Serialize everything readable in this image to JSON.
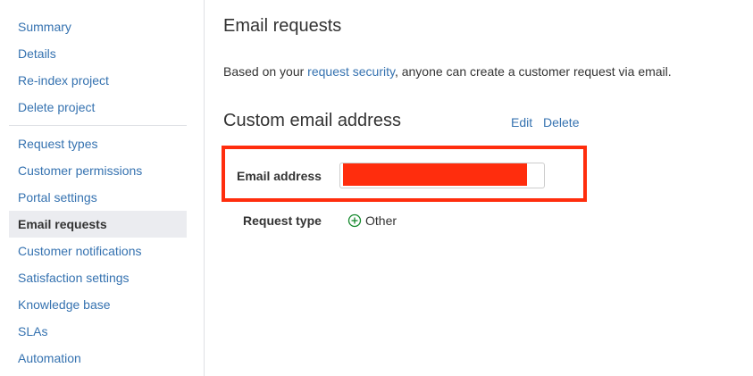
{
  "sidebar": {
    "group1": [
      {
        "label": "Summary"
      },
      {
        "label": "Details"
      },
      {
        "label": "Re-index project"
      },
      {
        "label": "Delete project"
      }
    ],
    "group2": [
      {
        "label": "Request types"
      },
      {
        "label": "Customer permissions"
      },
      {
        "label": "Portal settings"
      },
      {
        "label": "Email requests",
        "active": true
      },
      {
        "label": "Customer notifications"
      },
      {
        "label": "Satisfaction settings"
      },
      {
        "label": "Knowledge base"
      },
      {
        "label": "SLAs"
      },
      {
        "label": "Automation"
      }
    ]
  },
  "main": {
    "title": "Email requests",
    "intro_before": "Based on your ",
    "intro_link": "request security",
    "intro_after": ", anyone can create a customer request via email.",
    "section_title": "Custom email address",
    "edit_label": "Edit",
    "delete_label": "Delete",
    "email_label": "Email address",
    "email_value": "",
    "request_type_label": "Request type",
    "request_type_value": "Other"
  },
  "colors": {
    "link": "#3572b0",
    "highlight": "#ff2d0d",
    "active_bg": "#ebecf0",
    "plus_icon": "#14892c"
  }
}
